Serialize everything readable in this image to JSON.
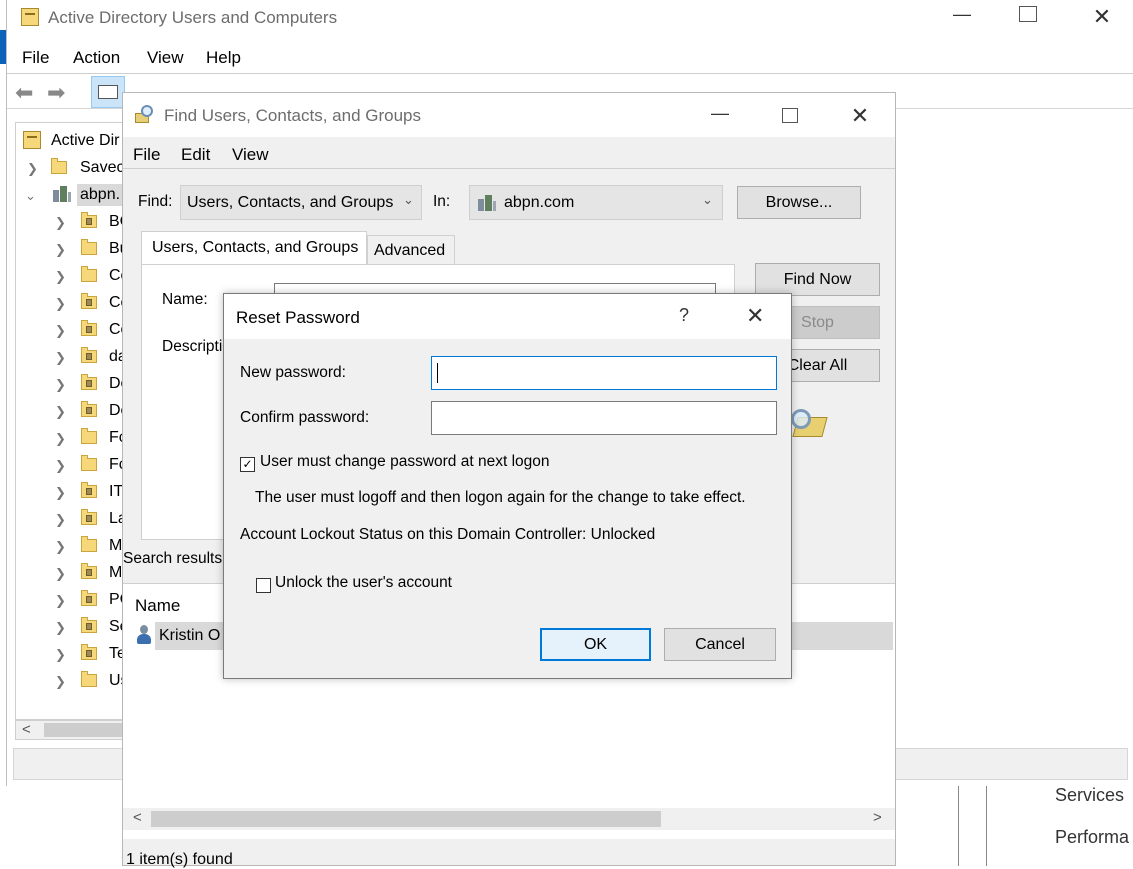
{
  "main_window": {
    "title": "Active Directory Users and Computers",
    "menu": [
      "File",
      "Action",
      "View",
      "Help"
    ],
    "tree": {
      "root": "Active Dir",
      "saved": "Savec",
      "domain": "abpn.",
      "children": [
        "BC",
        "Bu",
        "Cc",
        "Cc",
        "Cc",
        "da",
        "De",
        "De",
        "Fc",
        "Fc",
        "IT",
        "La",
        "M",
        "M",
        "PC",
        "Se",
        "Te",
        "Us"
      ]
    },
    "scroll_left": "<"
  },
  "background_right": {
    "item1": "Services",
    "item2": "Performa"
  },
  "find_dialog": {
    "title": "Find Users, Contacts, and Groups",
    "menu": [
      "File",
      "Edit",
      "View"
    ],
    "find_label": "Find:",
    "find_value": "Users, Contacts, and Groups",
    "in_label": "In:",
    "in_value": "abpn.com",
    "browse_label": "Browse...",
    "tabs": [
      "Users, Contacts, and Groups",
      "Advanced"
    ],
    "name_label": "Name:",
    "description_label": "Descriptic",
    "find_now_label": "Find Now",
    "stop_label": "Stop",
    "clear_all_label": "Clear All",
    "search_results_label": "Search results:",
    "results_header": "Name",
    "result_row": "Kristin O",
    "status": "1 item(s) found",
    "scroll_left": "<",
    "scroll_right": ">"
  },
  "reset_dialog": {
    "title": "Reset Password",
    "help": "?",
    "close": "✕",
    "new_password_label": "New password:",
    "new_password_value": "",
    "confirm_password_label": "Confirm password:",
    "confirm_password_value": "",
    "must_change_label": "User must change password at next logon",
    "must_change_checked": true,
    "info_text": "The user must logoff and then logon again for the change to take effect.",
    "lockout_text": "Account Lockout Status on this Domain Controller: Unlocked",
    "unlock_label": "Unlock the user's account",
    "unlock_checked": false,
    "ok_label": "OK",
    "cancel_label": "Cancel"
  },
  "colors": {
    "accent": "#0078d7",
    "dialog_bg": "#f0f0f0",
    "folder_yellow": "#f6d77a"
  }
}
